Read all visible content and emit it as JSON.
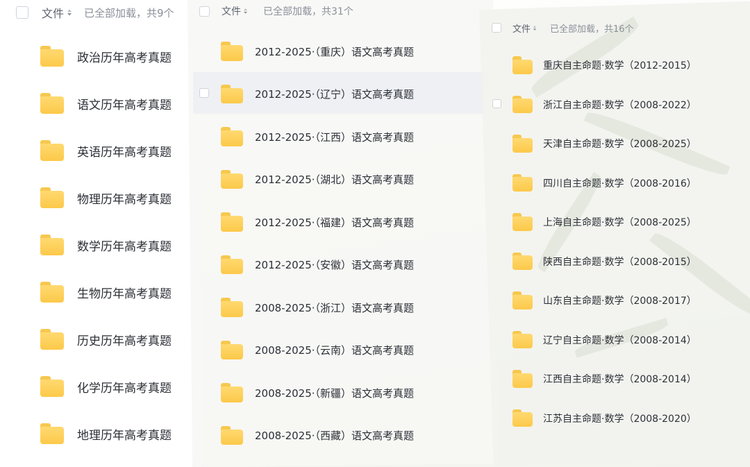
{
  "panels": [
    {
      "header": {
        "label": "文件",
        "count": "已全部加载，共9个"
      },
      "items": [
        "政治历年高考真题",
        "语文历年高考真题",
        "英语历年高考真题",
        "物理历年高考真题",
        "数学历年高考真题",
        "生物历年高考真题",
        "历史历年高考真题",
        "化学历年高考真题",
        "地理历年高考真题"
      ]
    },
    {
      "header": {
        "label": "文件",
        "count": "已全部加载，共31个"
      },
      "items": [
        "2012-2025·（重庆）语文高考真题",
        "2012-2025·（辽宁）语文高考真题",
        "2012-2025·（江西）语文高考真题",
        "2012-2025·（湖北）语文高考真题",
        "2012-2025·（福建）语文高考真题",
        "2012-2025·（安徽）语文高考真题",
        "2008-2025·（浙江）语文高考真题",
        "2008-2025·（云南）语文高考真题",
        "2008-2025·（新疆）语文高考真题",
        "2008-2025·（西藏）语文高考真题"
      ]
    },
    {
      "header": {
        "label": "文件",
        "count": "已全部加载，共16个"
      },
      "items": [
        "重庆自主命题·数学（2012-2015）",
        "浙江自主命题·数学（2008-2022）",
        "天津自主命题·数学（2008-2025）",
        "四川自主命题·数学（2008-2016）",
        "上海自主命题·数学（2008-2025）",
        "陕西自主命题·数学（2008-2015）",
        "山东自主命题·数学（2008-2017）",
        "辽宁自主命题·数学（2008-2014）",
        "江西自主命题·数学（2008-2014）",
        "江苏自主命题·数学（2008-2020）"
      ]
    }
  ],
  "icons": {
    "folder": "folder-icon",
    "sort": "sort-icon",
    "checkbox": "checkbox"
  },
  "colors": {
    "folder": "#fcc94a",
    "text": "#2b2f36",
    "muted": "#8a9099"
  }
}
